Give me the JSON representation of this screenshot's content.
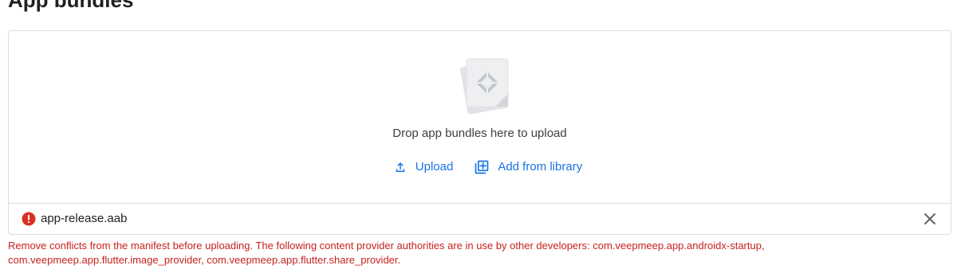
{
  "page": {
    "title": "App bundles"
  },
  "drop_zone": {
    "prompt": "Drop app bundles here to upload",
    "upload_label": "Upload",
    "library_label": "Add from library"
  },
  "file": {
    "name": "app-release.aab",
    "status_icon": "error-icon",
    "remove_icon": "close-icon"
  },
  "error": {
    "line1": "Remove conflicts from the manifest before uploading. The following content provider authorities are in use by other developers: com.veepmeep.app.androidx-startup,",
    "line2": "com.veepmeep.app.flutter.image_provider, com.veepmeep.app.flutter.share_provider."
  },
  "colors": {
    "accent": "#1a73e8",
    "error": "#c5221f",
    "border": "#dadce0"
  }
}
